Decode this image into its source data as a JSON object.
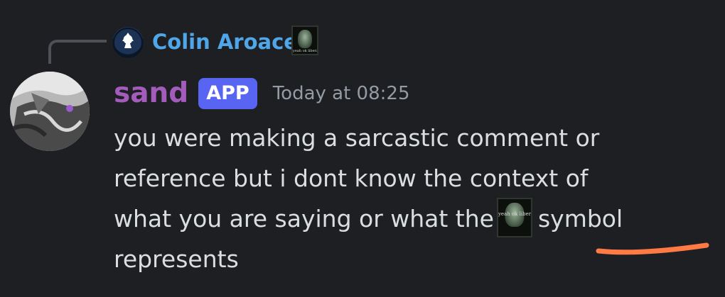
{
  "reply": {
    "author": "Colin Aroace",
    "emoji_name": "yeah-ok-liberal-emoji",
    "emoji_caption": "yeah ok liberal"
  },
  "message": {
    "author": "sand",
    "badge": "APP",
    "timestamp": "Today at 08:25",
    "lines": [
      "you were making a sarcastic comment or",
      "reference but i dont know the context of",
      "what you are saying or what the",
      "symbol",
      "represents"
    ],
    "inline_emoji_caption": "yeah ok liberal"
  },
  "colors": {
    "background": "#1e1f22",
    "author_sand": "#a35bbc",
    "author_colin": "#4fa6e8",
    "app_badge": "#5865f2",
    "annotation_underline": "#ff7a45"
  }
}
